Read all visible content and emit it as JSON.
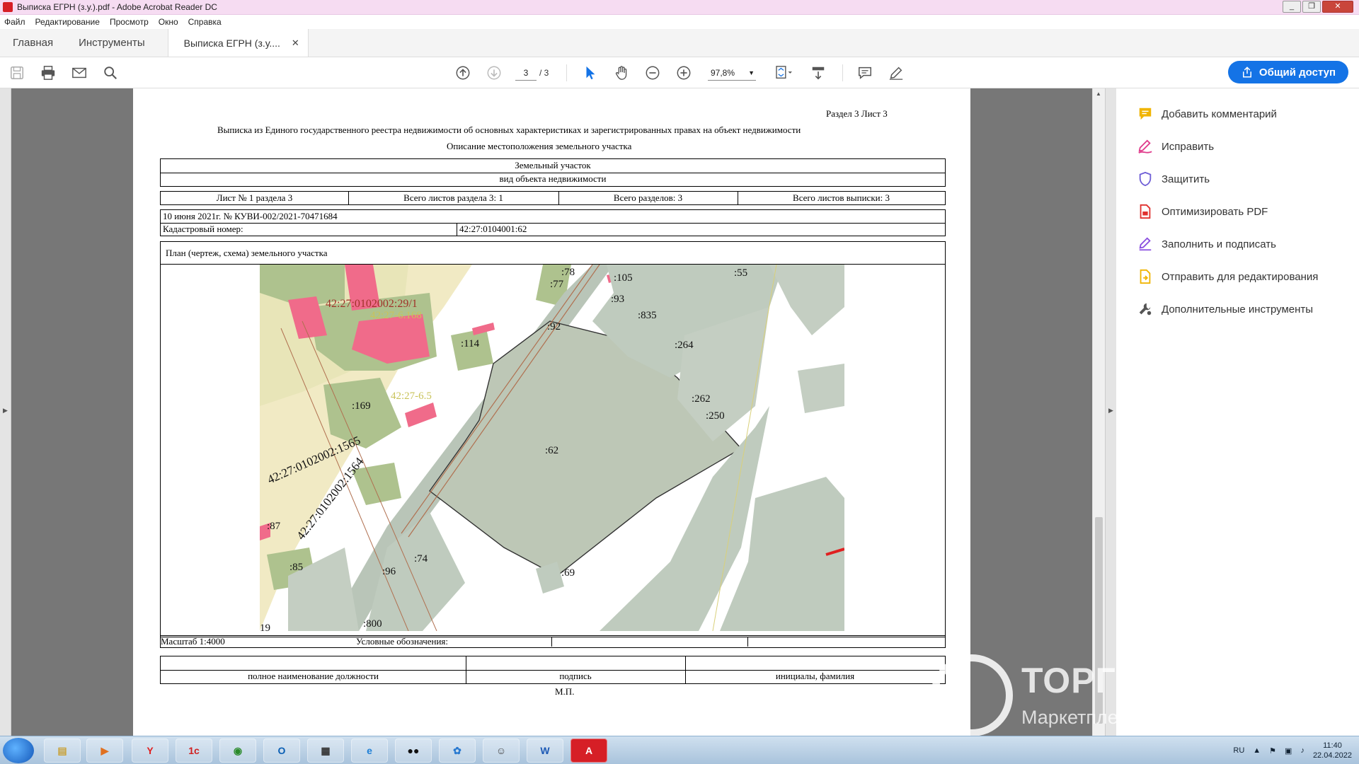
{
  "window": {
    "title": "Выписка ЕГРН (з.у.).pdf - Adobe Acrobat Reader DC",
    "controls": [
      "_",
      "❐",
      "✕"
    ]
  },
  "menu": [
    "Файл",
    "Редактирование",
    "Просмотр",
    "Окно",
    "Справка"
  ],
  "tabs": {
    "home": "Главная",
    "tools": "Инструменты",
    "document": "Выписка ЕГРН (з.у....",
    "close": "✕"
  },
  "toolbar": {
    "current_page": "3",
    "total_pages": "/ 3",
    "zoom": "97,8%",
    "share_label": "Общий доступ"
  },
  "document": {
    "section_sheet": "Раздел 3    Лист 3",
    "heading": "Выписка из Единого государственного реестра недвижимости об основных характеристиках и зарегистрированных правах на объект недвижимости",
    "subheading": "Описание местоположения земельного участка",
    "object_type": "Земельный участок",
    "object_type_caption": "вид объекта недвижимости",
    "sheet_info": [
      "Лист № 1 раздела 3",
      "Всего листов раздела 3: 1",
      "Всего разделов: 3",
      "Всего листов выписки: 3"
    ],
    "date_number": "10 июня 2021г. № КУВИ-002/2021-70471684",
    "cadastral_label": "Кадастровый номер:",
    "cadastral_value": "42:27:0104001:62",
    "plan_title": "План (чертеж, схема) земельного участка",
    "map_labels": {
      "l78": ":78",
      "l77": ":77",
      "l105": ":105",
      "l55": ":55",
      "l93": ":93",
      "q29": "42:27:0102002:29/1",
      "q6168": "42:27-6.168",
      "l835": ":835",
      "l92": ":92",
      "l114": ":114",
      "l264": ":264",
      "q65": "42:27-6.5",
      "l169": ":169",
      "l262": ":262",
      "l250": ":250",
      "l62": ":62",
      "q1565": "42:27:0102002:1565",
      "q1564": "42:27:0102002:1564",
      "l87": ":87",
      "l74": ":74",
      "l85": ":85",
      "l96": ":96",
      "l69": ":69",
      "l800": ":800",
      "l19": "19"
    },
    "scale": "Масштаб 1:4000",
    "legend": "Условные обозначения:",
    "sign_cols": [
      "полное наименование должности",
      "подпись",
      "инициалы, фамилия"
    ],
    "stamp": "М.П."
  },
  "right_panel": {
    "items": [
      {
        "label": "Добавить комментарий",
        "icon": "comment-icon",
        "color": "#f0b400"
      },
      {
        "label": "Исправить",
        "icon": "edit-pen-icon",
        "color": "#e03c8c"
      },
      {
        "label": "Защитить",
        "icon": "shield-icon",
        "color": "#6e5ed6"
      },
      {
        "label": "Оптимизировать PDF",
        "icon": "optimize-pdf-icon",
        "color": "#e0302e"
      },
      {
        "label": "Заполнить и подписать",
        "icon": "fill-sign-icon",
        "color": "#8a4ee0"
      },
      {
        "label": "Отправить для редактирования",
        "icon": "send-review-icon",
        "color": "#f0b400"
      },
      {
        "label": "Дополнительные инструменты",
        "icon": "more-tools-icon",
        "color": "#555555"
      }
    ]
  },
  "watermark": {
    "brand": "ТОРГИ РОССИИ",
    "tagline": "Маркетплейс по торгам в РФ"
  },
  "taskbar": {
    "language": "RU",
    "time": "11:40",
    "date": "22.04.2022",
    "apps": [
      "Проводник",
      "Медиа",
      "Яндекс",
      "1С",
      "Chrome",
      "Outlook",
      "Калькулятор",
      "Internet Explorer",
      "Zoom",
      "Мессенджер",
      "Приложение",
      "Word",
      "Acrobat"
    ]
  }
}
